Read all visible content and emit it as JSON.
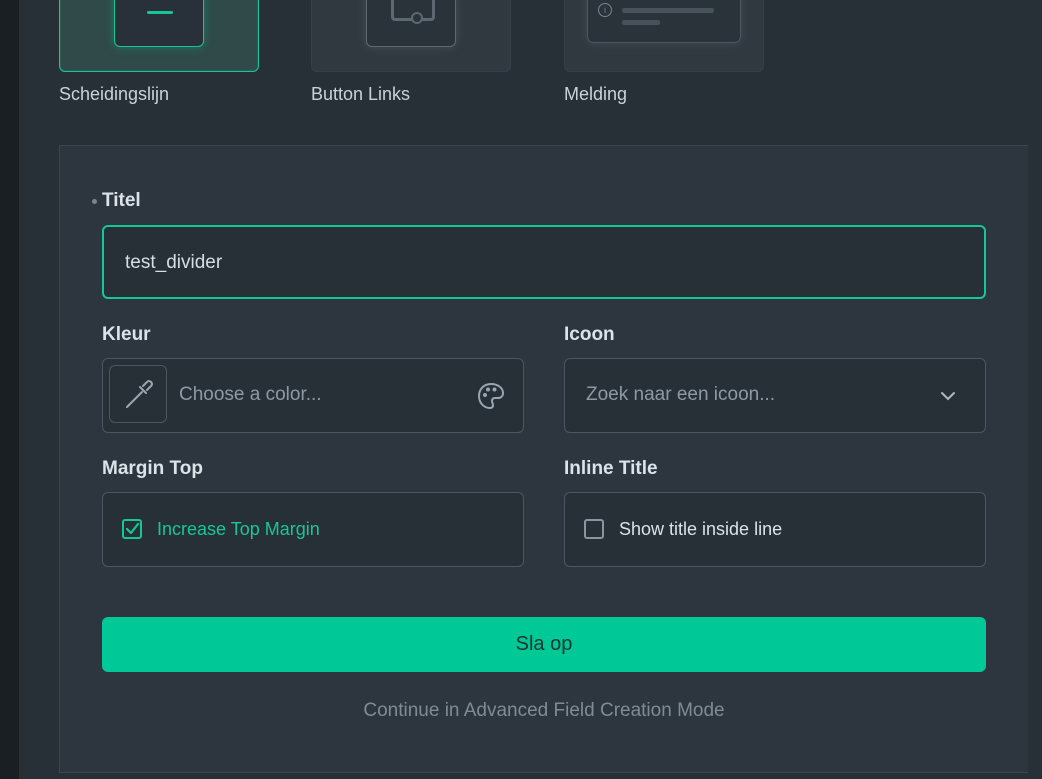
{
  "field_types": [
    {
      "label": "Scheidingslijn",
      "selected": true,
      "icon": "divider-preview-icon"
    },
    {
      "label": "Button Links",
      "selected": false,
      "icon": "button-link-preview-icon"
    },
    {
      "label": "Melding",
      "selected": false,
      "icon": "notification-preview-icon"
    }
  ],
  "form": {
    "title": {
      "label": "Titel",
      "value": "test_divider"
    },
    "color": {
      "label": "Kleur",
      "placeholder": "Choose a color..."
    },
    "icon": {
      "label": "Icoon",
      "placeholder": "Zoek naar een icoon..."
    },
    "margin_top": {
      "label": "Margin Top",
      "checkbox_label": "Increase Top Margin",
      "checked": true
    },
    "inline_title": {
      "label": "Inline Title",
      "checkbox_label": "Show title inside line",
      "checked": false
    },
    "save_label": "Sla op",
    "advanced_link": "Continue in Advanced Field Creation Mode"
  },
  "colors": {
    "accent": "#16c795",
    "background": "#283037",
    "field_bg": "#2d363e",
    "button": "#00c896"
  }
}
